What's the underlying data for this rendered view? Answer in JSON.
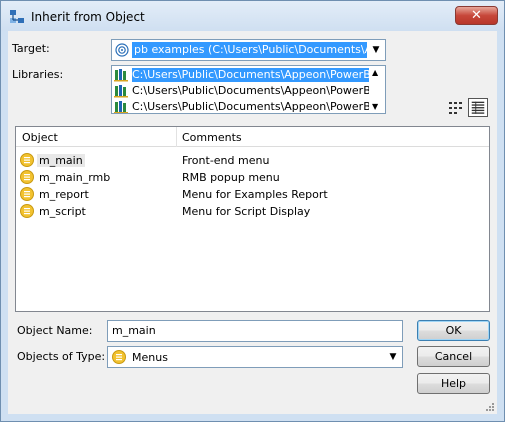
{
  "window": {
    "title": "Inherit from Object",
    "close_glyph": "✕",
    "title_icon": "inherit-icon"
  },
  "target": {
    "label": "Target:",
    "value": "pb examples (C:\\Users\\Public\\Documents\\Appeon",
    "icon": "target-icon"
  },
  "libraries": {
    "label": "Libraries:",
    "items": [
      {
        "path": "C:\\Users\\Public\\Documents\\Appeon\\PowerBuilde",
        "selected": true
      },
      {
        "path": "C:\\Users\\Public\\Documents\\Appeon\\PowerBuilde",
        "selected": false
      },
      {
        "path": "C:\\Users\\Public\\Documents\\Appeon\\PowerBuilde",
        "selected": false
      }
    ],
    "icon": "library-icon"
  },
  "view_toggle": {
    "list_icon": "list-view-icon",
    "detail_icon": "details-view-icon"
  },
  "objects": {
    "columns": [
      "Object",
      "Comments"
    ],
    "rows": [
      {
        "name": "m_main",
        "comment": "Front-end menu"
      },
      {
        "name": "m_main_rmb",
        "comment": "RMB popup menu"
      },
      {
        "name": "m_report",
        "comment": "Menu for Examples Report"
      },
      {
        "name": "m_script",
        "comment": "Menu for Script Display"
      }
    ],
    "icon": "menu-object-icon"
  },
  "object_name": {
    "label": "Object Name:",
    "value": "m_main"
  },
  "objects_of_type": {
    "label": "Objects of Type:",
    "value": "Menus"
  },
  "buttons": {
    "ok": "OK",
    "cancel": "Cancel",
    "help": "Help"
  },
  "colors": {
    "selection": "#3399ff",
    "menu_icon": "#f2c230"
  }
}
